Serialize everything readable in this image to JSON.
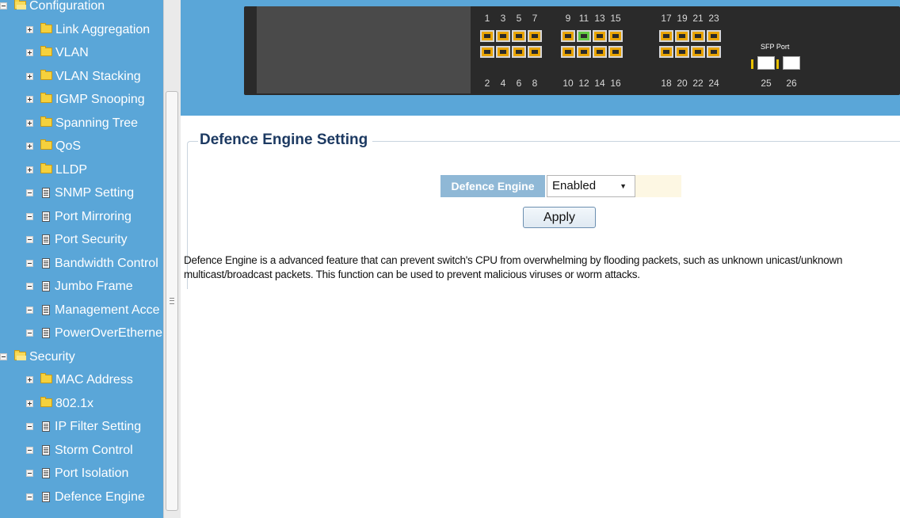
{
  "sidebar": {
    "items": [
      {
        "label": "Configuration",
        "type": "folder-open",
        "toggle": "minus",
        "level": 0
      },
      {
        "label": "Link Aggregation",
        "type": "folder",
        "toggle": "plus",
        "level": 1
      },
      {
        "label": "VLAN",
        "type": "folder",
        "toggle": "plus",
        "level": 1
      },
      {
        "label": "VLAN Stacking",
        "type": "folder",
        "toggle": "plus",
        "level": 1
      },
      {
        "label": "IGMP Snooping",
        "type": "folder",
        "toggle": "plus",
        "level": 1
      },
      {
        "label": "Spanning Tree",
        "type": "folder",
        "toggle": "plus",
        "level": 1
      },
      {
        "label": "QoS",
        "type": "folder",
        "toggle": "plus",
        "level": 1
      },
      {
        "label": "LLDP",
        "type": "folder",
        "toggle": "plus",
        "level": 1
      },
      {
        "label": "SNMP Setting",
        "type": "doc",
        "toggle": "minus",
        "level": 1
      },
      {
        "label": "Port Mirroring",
        "type": "doc",
        "toggle": "minus",
        "level": 1
      },
      {
        "label": "Port Security",
        "type": "doc",
        "toggle": "minus",
        "level": 1
      },
      {
        "label": "Bandwidth Control",
        "type": "doc",
        "toggle": "minus",
        "level": 1
      },
      {
        "label": "Jumbo Frame",
        "type": "doc",
        "toggle": "minus",
        "level": 1
      },
      {
        "label": "Management Acce",
        "type": "doc",
        "toggle": "minus",
        "level": 1
      },
      {
        "label": "PowerOverEtherne",
        "type": "doc",
        "toggle": "minus",
        "level": 1
      },
      {
        "label": "Security",
        "type": "folder-open",
        "toggle": "minus",
        "level": 0
      },
      {
        "label": "MAC Address",
        "type": "folder",
        "toggle": "plus",
        "level": 1
      },
      {
        "label": "802.1x",
        "type": "folder",
        "toggle": "plus",
        "level": 1
      },
      {
        "label": "IP Filter Setting",
        "type": "doc",
        "toggle": "minus",
        "level": 1
      },
      {
        "label": "Storm Control",
        "type": "doc",
        "toggle": "minus",
        "level": 1
      },
      {
        "label": "Port Isolation",
        "type": "doc",
        "toggle": "minus",
        "level": 1
      },
      {
        "label": "Defence Engine",
        "type": "doc",
        "toggle": "minus",
        "level": 1
      }
    ]
  },
  "switch_panel": {
    "top_port_numbers": [
      "1",
      "3",
      "5",
      "7",
      "9",
      "11",
      "13",
      "15",
      "17",
      "19",
      "21",
      "23"
    ],
    "bottom_port_numbers": [
      "2",
      "4",
      "6",
      "8",
      "10",
      "12",
      "14",
      "16",
      "18",
      "20",
      "22",
      "24"
    ],
    "active_port": "11",
    "sfp_caption": "SFP Port",
    "sfp_port_numbers": [
      "25",
      "26"
    ]
  },
  "main": {
    "section_title": "Defence Engine Setting",
    "setting_label": "Defence Engine",
    "setting_value": "Enabled",
    "apply_label": "Apply",
    "description": "Defence Engine is a advanced feature that can prevent switch's CPU from overwhelming by flooding packets, such as unknown unicast/unknown multicast/broadcast packets. This function can be used to prevent malicious viruses or worm attacks."
  },
  "colors": {
    "accent": "#5aa6d8",
    "title": "#1d3a62",
    "label_bg": "#8fb8d6",
    "port_amber": "#e9a400",
    "port_active": "#62c842"
  }
}
